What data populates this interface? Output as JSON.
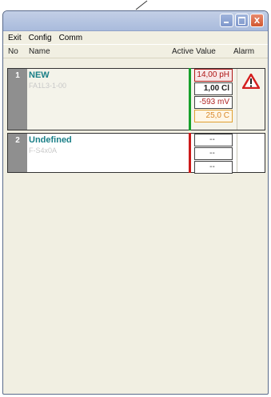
{
  "window": {
    "close_symbol": "x"
  },
  "menu": [
    "Exit",
    "Config",
    "Comm"
  ],
  "headers": {
    "no": "No",
    "name": "Name",
    "active_value": "Active Value",
    "alarm": "Alarm"
  },
  "channels": [
    {
      "number": "1",
      "name": "NEW",
      "subtitle": "FA1L3-1-00",
      "values": [
        "14,00 pH",
        "1,00 Cl",
        "-593 mV",
        "25,0 C"
      ],
      "alarm_icon": "warning-triangle-icon"
    },
    {
      "number": "2",
      "name": "Undefined",
      "subtitle": "F-S4x0A",
      "values": [
        "--",
        "--",
        "--"
      ]
    }
  ],
  "colors": {
    "name_text": "#1a7f87",
    "alarm_red": "#d42020",
    "ok_green": "#17a02b",
    "warn_red": "#cc1a1a"
  }
}
